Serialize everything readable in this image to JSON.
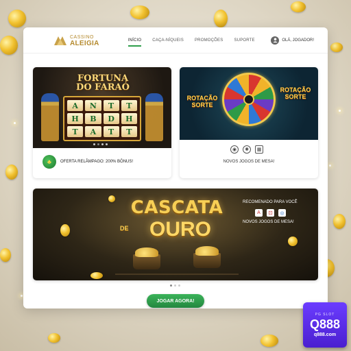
{
  "brand": {
    "line1": "CASSINO",
    "line2": "ALEIGIA"
  },
  "nav": {
    "items": [
      {
        "label": "INÍCIO",
        "active": true
      },
      {
        "label": "CAÇA-NÍQUEIS",
        "active": false
      },
      {
        "label": "PROMOÇÕES",
        "active": false
      },
      {
        "label": "SUPORTE",
        "active": false
      }
    ],
    "user_label": "OLÁ, JOGADOR!"
  },
  "card1": {
    "game_title_line1": "FORTUNA",
    "game_title_line2": "DO FARAÓ",
    "reels": [
      "A",
      "N",
      "T",
      "T",
      "H",
      "B",
      "D",
      "H",
      "T",
      "A",
      "T",
      "T"
    ],
    "offer_text": "OFERTA RELÂMPAGO: 200% BÔNUS!",
    "carousel_dots": 4,
    "carousel_active": 1
  },
  "card2": {
    "game_title_left": "ROTAÇÃO SORTE",
    "game_title_right": "ROTAÇÃO SORTE",
    "new_games": "NOVOS JOGOS DE MESA!"
  },
  "banner": {
    "title_top": "CASCATA",
    "title_de": "DE",
    "title_main": "OURO",
    "recommended": "RECOMENADO PARA VOCÊ",
    "recommended_sub": "NOVOS JOGOS DE MESA!",
    "carousel_dots": 3,
    "carousel_active": 0
  },
  "cta": {
    "label": "JOGAR AGORA!"
  },
  "badge": {
    "top": "PG SLOT",
    "main": "Q888",
    "url": "q888.com"
  },
  "colors": {
    "accent_green": "#2e9e4a",
    "gold": "#b58a2e",
    "badge_purple": "#5a2ee6"
  }
}
